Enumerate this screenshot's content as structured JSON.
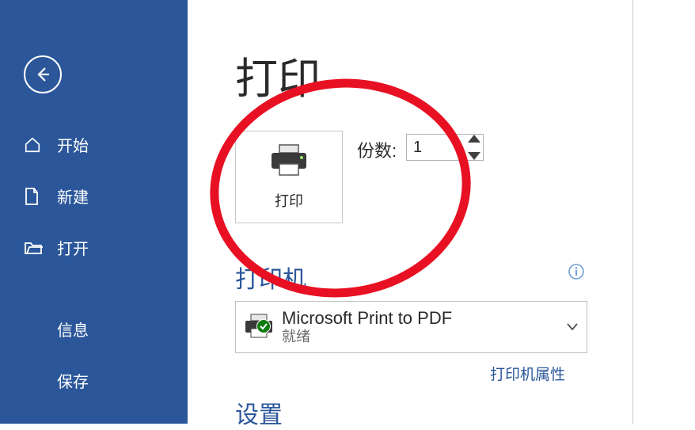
{
  "sidebar": {
    "items": [
      {
        "label": "开始"
      },
      {
        "label": "新建"
      },
      {
        "label": "打开"
      },
      {
        "label": "信息"
      },
      {
        "label": "保存"
      }
    ]
  },
  "page": {
    "title": "打印"
  },
  "print_tile": {
    "label": "打印"
  },
  "copies": {
    "label": "份数:",
    "value": "1"
  },
  "sections": {
    "printer": "打印机",
    "settings": "设置"
  },
  "printer": {
    "name": "Microsoft Print to PDF",
    "status": "就绪",
    "properties_link": "打印机属性"
  }
}
